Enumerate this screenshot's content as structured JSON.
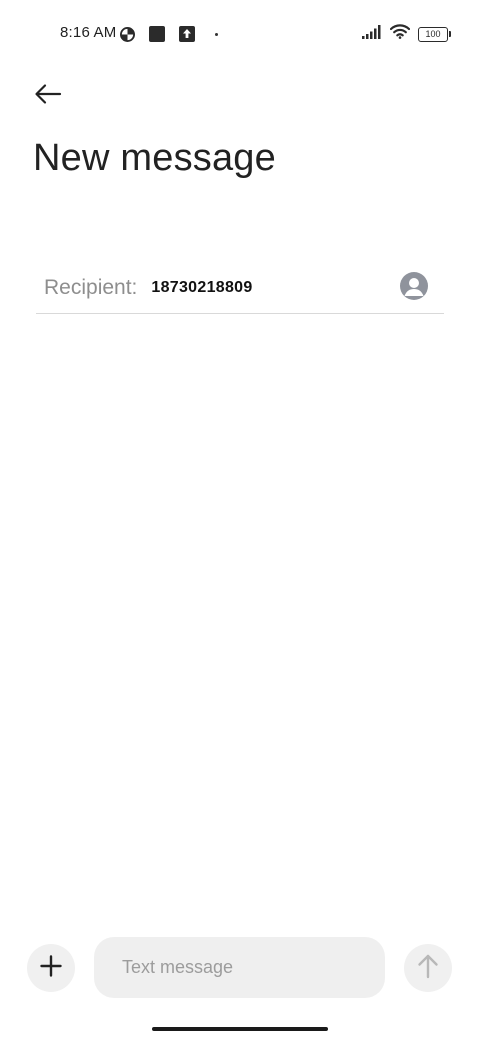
{
  "status_bar": {
    "time": "8:16 AM",
    "battery_level": "100",
    "left_icons": [
      "data-saver-icon",
      "notification-square-icon",
      "upload-icon",
      "dot-icon"
    ],
    "right_icons": [
      "signal-icon",
      "wifi-icon",
      "battery-icon"
    ]
  },
  "header": {
    "back_icon": "arrow-left-icon",
    "title": "New message"
  },
  "recipient": {
    "label": "Recipient:",
    "value": "18730218809",
    "contact_icon": "person-circle-icon"
  },
  "compose": {
    "attach_icon": "plus-icon",
    "placeholder": "Text message",
    "value": "",
    "send_icon": "arrow-up-icon"
  },
  "colors": {
    "background": "#ffffff",
    "label_gray": "#8e8e8e",
    "field_bg": "#efefef",
    "divider": "#d9d9d9",
    "contact_icon_bg": "#8f939c"
  }
}
